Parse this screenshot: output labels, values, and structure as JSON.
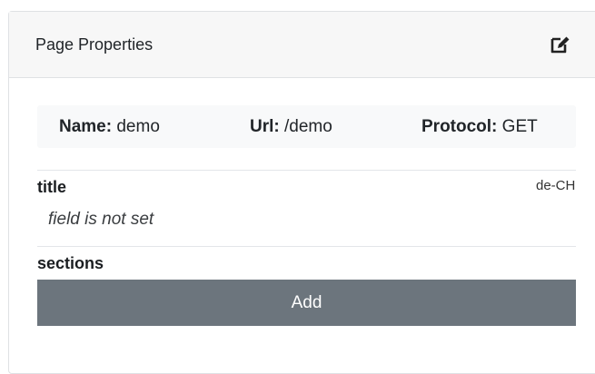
{
  "panel": {
    "title": "Page Properties",
    "edit_icon": "edit-icon"
  },
  "info": {
    "name_label": "Name:",
    "name_value": "demo",
    "url_label": "Url:",
    "url_value": "/demo",
    "protocol_label": "Protocol:",
    "protocol_value": "GET"
  },
  "fields": {
    "title": {
      "label": "title",
      "locale": "de-CH",
      "empty_text": "field is not set"
    },
    "sections": {
      "label": "sections",
      "add_label": "Add"
    }
  },
  "colors": {
    "add_button": "#6c757d",
    "header_bg": "#f7f7f7",
    "info_bg": "#f8f9fa"
  }
}
